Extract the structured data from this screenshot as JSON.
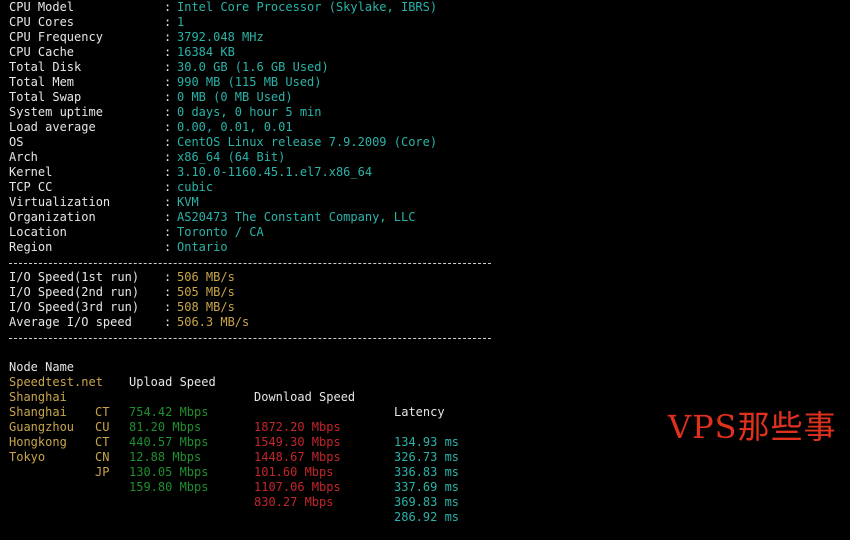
{
  "sysinfo": [
    {
      "key": "CPU Model",
      "value": "Intel Core Processor (Skylake, IBRS)"
    },
    {
      "key": "CPU Cores",
      "value": "1"
    },
    {
      "key": "CPU Frequency",
      "value": "3792.048 MHz"
    },
    {
      "key": "CPU Cache",
      "value": "16384 KB"
    },
    {
      "key": "Total Disk",
      "value": "30.0 GB (1.6 GB Used)"
    },
    {
      "key": "Total Mem",
      "value": "990 MB (115 MB Used)"
    },
    {
      "key": "Total Swap",
      "value": "0 MB (0 MB Used)"
    },
    {
      "key": "System uptime",
      "value": "0 days, 0 hour 5 min"
    },
    {
      "key": "Load average",
      "value": "0.00, 0.01, 0.01"
    },
    {
      "key": "OS",
      "value": "CentOS Linux release 7.9.2009 (Core)"
    },
    {
      "key": "Arch",
      "value": "x86_64 (64 Bit)"
    },
    {
      "key": "Kernel",
      "value": "3.10.0-1160.45.1.el7.x86_64"
    },
    {
      "key": "TCP CC",
      "value": "cubic"
    },
    {
      "key": "Virtualization",
      "value": "KVM"
    },
    {
      "key": "Organization",
      "value": "AS20473 The Constant Company, LLC"
    },
    {
      "key": "Location",
      "value": "Toronto / CA"
    },
    {
      "key": "Region",
      "value": "Ontario"
    }
  ],
  "separator": ":",
  "io": [
    {
      "key": "I/O Speed(1st run)",
      "value": "506 MB/s"
    },
    {
      "key": "I/O Speed(2nd run)",
      "value": "505 MB/s"
    },
    {
      "key": "I/O Speed(3rd run)",
      "value": "508 MB/s"
    },
    {
      "key": "Average I/O speed",
      "value": "506.3 MB/s"
    }
  ],
  "speedtest": {
    "headers": {
      "node": "Node Name",
      "upload": "Upload Speed",
      "download": "Download Speed",
      "latency": "Latency"
    },
    "rows": [
      {
        "node": "Speedtest.net",
        "isp": "",
        "upload": "754.42 Mbps",
        "download": "1872.20 Mbps",
        "latency": "134.93 ms"
      },
      {
        "node": "Shanghai",
        "isp": "CT",
        "upload": "81.20 Mbps",
        "download": "1549.30 Mbps",
        "latency": "326.73 ms"
      },
      {
        "node": "Shanghai",
        "isp": "CU",
        "upload": "440.57 Mbps",
        "download": "1448.67 Mbps",
        "latency": "336.83 ms"
      },
      {
        "node": "Guangzhou",
        "isp": "CT",
        "upload": "12.88 Mbps",
        "download": "101.60 Mbps",
        "latency": "337.69 ms"
      },
      {
        "node": "Hongkong",
        "isp": "CN",
        "upload": "130.05 Mbps",
        "download": "1107.06 Mbps",
        "latency": "369.83 ms"
      },
      {
        "node": "Tokyo",
        "isp": "JP",
        "upload": "159.80 Mbps",
        "download": "830.27 Mbps",
        "latency": "286.92 ms"
      }
    ]
  },
  "watermark": "VPS那些事"
}
